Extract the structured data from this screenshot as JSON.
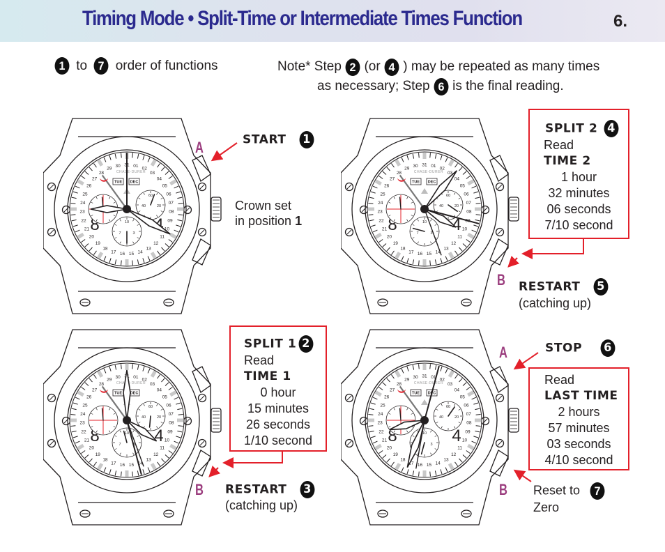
{
  "header": {
    "title": "Timing Mode • Split-Time or Intermediate Times Function",
    "page_number": "6."
  },
  "legend": {
    "from_step": "1",
    "to_word": "to",
    "to_step": "7",
    "text": "order of functions"
  },
  "note": {
    "prefix": "Note* Step",
    "step_a": "2",
    "or_text": "(or",
    "step_b": "4",
    "suffix": ") may be repeated as many times",
    "line2_prefix": "as necessary; Step",
    "step_final": "6",
    "line2_suffix": "is the final reading."
  },
  "watch_face": {
    "brand": "CHASE-DURER",
    "day": "TUE",
    "month": "DEC",
    "numeral_left": "8",
    "numeral_right": "4",
    "sub_right_labels": [
      "60",
      "20",
      "40"
    ],
    "sub_bottom_labels": [
      "10",
      "3",
      "7"
    ]
  },
  "colors": {
    "title": "#2b2a8e",
    "accent_red": "#e3202a",
    "pusher_letter": "#9b3d7e",
    "header_bg": "#dde3ee"
  },
  "panels": {
    "start": {
      "pusher": "A",
      "action": "START",
      "step": "1",
      "crown_line1": "Crown set",
      "crown_line2": "in position",
      "crown_position": "1"
    },
    "split2": {
      "action": "SPLIT 2",
      "step": "4",
      "read": "Read",
      "time_label": "TIME 2",
      "hours": "1 hour",
      "minutes": "32 minutes",
      "seconds": "06 seconds",
      "tenths": "7/10 second",
      "pusher": "B",
      "restart_action": "RESTART",
      "restart_step": "5",
      "restart_note": "(catching up)"
    },
    "split1": {
      "action": "SPLIT 1",
      "step": "2",
      "read": "Read",
      "time_label": "TIME 1",
      "hours": "0 hour",
      "minutes": "15 minutes",
      "seconds": "26 seconds",
      "tenths": "1/10 second",
      "pusher": "B",
      "restart_action": "RESTART",
      "restart_step": "3",
      "restart_note": "(catching up)"
    },
    "stop": {
      "pusher_a": "A",
      "action": "STOP",
      "step": "6",
      "read": "Read",
      "time_label": "LAST TIME",
      "hours": "2 hours",
      "minutes": "57 minutes",
      "seconds": "03 seconds",
      "tenths": "4/10 second",
      "pusher_b": "B",
      "reset_line1": "Reset to",
      "reset_line2": "Zero",
      "reset_step": "7"
    }
  }
}
